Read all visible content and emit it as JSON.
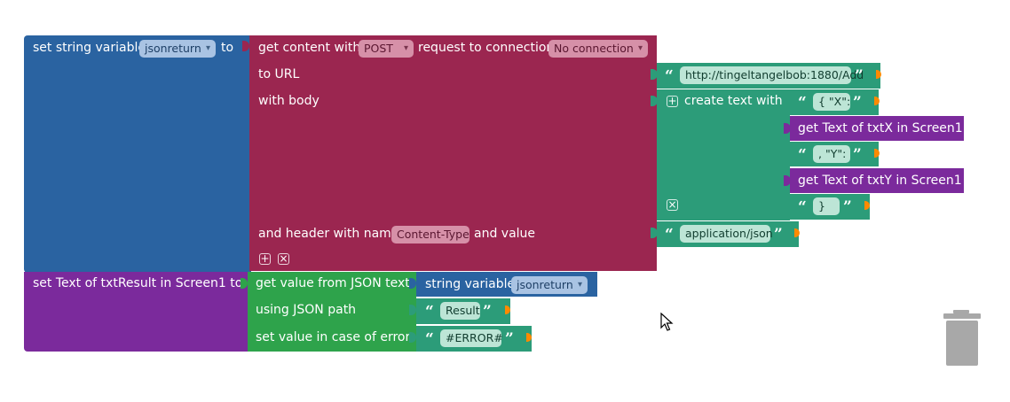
{
  "colors": {
    "variable": "#2a63a1",
    "web": "#9b2650",
    "text": "#2c9c79",
    "component": "#7b2a9c",
    "json": "#2ea34b",
    "trash": "#a8a8a8"
  },
  "set_var_block": {
    "label": "set string variable",
    "variable_name": "jsonreturn",
    "to_label": "to"
  },
  "get_content_block": {
    "label": "get content with",
    "method": "POST",
    "request_label": "request to connection",
    "connection": "No connection",
    "url_label": "to URL",
    "body_label": "with body",
    "header_label": "and header with name",
    "header_name": "Content-Type",
    "value_label": "and value"
  },
  "url_text": "http://tingeltangelbob:1880/Add",
  "create_text_block": {
    "label": "create text with",
    "item1": "{ \"X\":",
    "item2_label": "get Text of txtX in Screen1",
    "item3": ", \"Y\":",
    "item4_label": "get Text of txtY in Screen1",
    "item5": "}"
  },
  "header_value_text": "application/json",
  "set_text_block": {
    "label": "set Text of txtResult in Screen1 to"
  },
  "json_block": {
    "label": "get value from JSON text",
    "path_label": "using JSON path",
    "error_label": "set value in case of error"
  },
  "string_var_block": {
    "label": "string variable",
    "variable_name": "jsonreturn"
  },
  "path_text": "Result",
  "error_text": "#ERROR#",
  "icons": {
    "quote_open": "“",
    "quote_close": "”",
    "plus": "+",
    "minus": "×"
  }
}
